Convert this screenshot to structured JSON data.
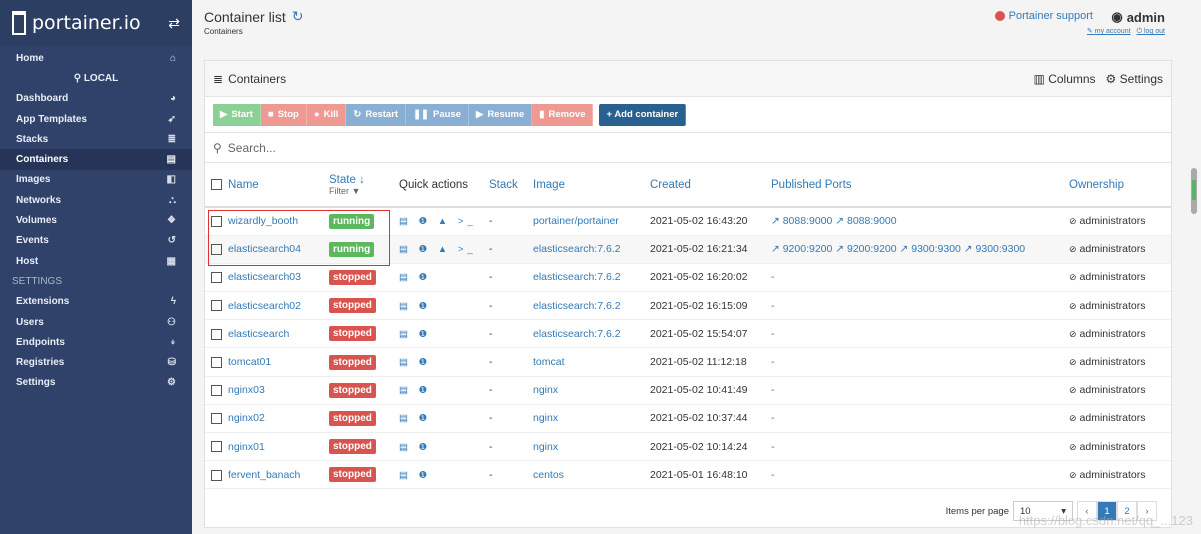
{
  "brand": {
    "name": "portainer.io"
  },
  "sidebar": {
    "items": [
      {
        "label": "Home",
        "icon": "home-icon",
        "glyph": "⌂"
      },
      {
        "label": "⚲ LOCAL",
        "icon": "",
        "glyph": "",
        "center": true
      },
      {
        "label": "Dashboard",
        "icon": "tachometer-icon",
        "glyph": "◕"
      },
      {
        "label": "App Templates",
        "icon": "rocket-icon",
        "glyph": "➶"
      },
      {
        "label": "Stacks",
        "icon": "th-list-icon",
        "glyph": "≣"
      },
      {
        "label": "Containers",
        "icon": "server-icon",
        "glyph": "▤",
        "active": true
      },
      {
        "label": "Images",
        "icon": "clone-icon",
        "glyph": "◧"
      },
      {
        "label": "Networks",
        "icon": "sitemap-icon",
        "glyph": "⛬"
      },
      {
        "label": "Volumes",
        "icon": "cubes-icon",
        "glyph": "❖"
      },
      {
        "label": "Events",
        "icon": "history-icon",
        "glyph": "↺"
      },
      {
        "label": "Host",
        "icon": "th-icon",
        "glyph": "▦"
      }
    ],
    "settings_heading": "SETTINGS",
    "settings_items": [
      {
        "label": "Extensions",
        "glyph": "ϟ"
      },
      {
        "label": "Users",
        "glyph": "⚇"
      },
      {
        "label": "Endpoints",
        "glyph": "⍖"
      },
      {
        "label": "Registries",
        "glyph": "⛁"
      },
      {
        "label": "Settings",
        "glyph": "⚙"
      }
    ]
  },
  "header": {
    "title": "Container list",
    "breadcrumb": "Containers",
    "support": "Portainer support",
    "user": "admin",
    "my_account": "my account",
    "log_out": "log out"
  },
  "panel": {
    "title": "Containers",
    "columns_label": "Columns",
    "settings_label": "Settings"
  },
  "toolbar": {
    "start": "Start",
    "stop": "Stop",
    "kill": "Kill",
    "restart": "Restart",
    "pause": "Pause",
    "resume": "Resume",
    "remove": "Remove",
    "add": "+ Add container"
  },
  "search": {
    "placeholder": "Search..."
  },
  "table": {
    "headers": {
      "name": "Name",
      "state": "State",
      "state_filter": "Filter",
      "quick_actions": "Quick actions",
      "stack": "Stack",
      "image": "Image",
      "created": "Created",
      "ports": "Published Ports",
      "ownership": "Ownership"
    },
    "rows": [
      {
        "name": "wizardly_booth",
        "state": "running",
        "actions": "▤ ❶ ▲ >_",
        "stack": "-",
        "image": "portainer/portainer",
        "created": "2021-05-02 16:43:20",
        "ports": "↗ 8088:9000  ↗ 8088:9000",
        "ownership": "administrators"
      },
      {
        "name": "elasticsearch04",
        "state": "running",
        "actions": "▤ ❶ ▲ >_",
        "stack": "-",
        "image": "elasticsearch:7.6.2",
        "created": "2021-05-02 16:21:34",
        "ports": "↗ 9200:9200  ↗ 9200:9200  ↗ 9300:9300  ↗ 9300:9300",
        "ownership": "administrators"
      },
      {
        "name": "elasticsearch03",
        "state": "stopped",
        "actions": "▤ ❶",
        "stack": "-",
        "image": "elasticsearch:7.6.2",
        "created": "2021-05-02 16:20:02",
        "ports": "-",
        "ownership": "administrators"
      },
      {
        "name": "elasticsearch02",
        "state": "stopped",
        "actions": "▤ ❶",
        "stack": "-",
        "image": "elasticsearch:7.6.2",
        "created": "2021-05-02 16:15:09",
        "ports": "-",
        "ownership": "administrators"
      },
      {
        "name": "elasticsearch",
        "state": "stopped",
        "actions": "▤ ❶",
        "stack": "-",
        "image": "elasticsearch:7.6.2",
        "created": "2021-05-02 15:54:07",
        "ports": "-",
        "ownership": "administrators"
      },
      {
        "name": "tomcat01",
        "state": "stopped",
        "actions": "▤ ❶",
        "stack": "-",
        "image": "tomcat",
        "created": "2021-05-02 11:12:18",
        "ports": "-",
        "ownership": "administrators"
      },
      {
        "name": "nginx03",
        "state": "stopped",
        "actions": "▤ ❶",
        "stack": "-",
        "image": "nginx",
        "created": "2021-05-02 10:41:49",
        "ports": "-",
        "ownership": "administrators"
      },
      {
        "name": "nginx02",
        "state": "stopped",
        "actions": "▤ ❶",
        "stack": "-",
        "image": "nginx",
        "created": "2021-05-02 10:37:44",
        "ports": "-",
        "ownership": "administrators"
      },
      {
        "name": "nginx01",
        "state": "stopped",
        "actions": "▤ ❶",
        "stack": "-",
        "image": "nginx",
        "created": "2021-05-02 10:14:24",
        "ports": "-",
        "ownership": "administrators"
      },
      {
        "name": "fervent_banach",
        "state": "stopped",
        "actions": "▤ ❶",
        "stack": "-",
        "image": "centos",
        "created": "2021-05-01 16:48:10",
        "ports": "-",
        "ownership": "administrators"
      }
    ]
  },
  "pagination": {
    "items_per_page_label": "Items per page",
    "items_per_page": "10",
    "pages": [
      "1",
      "2"
    ],
    "current": "1"
  },
  "watermark": "https://blog.csdn.net/qq_...123",
  "colors": {
    "sidebar": "#30426a",
    "link": "#337ab7",
    "running": "#5cb85c",
    "stopped": "#d9534f"
  }
}
